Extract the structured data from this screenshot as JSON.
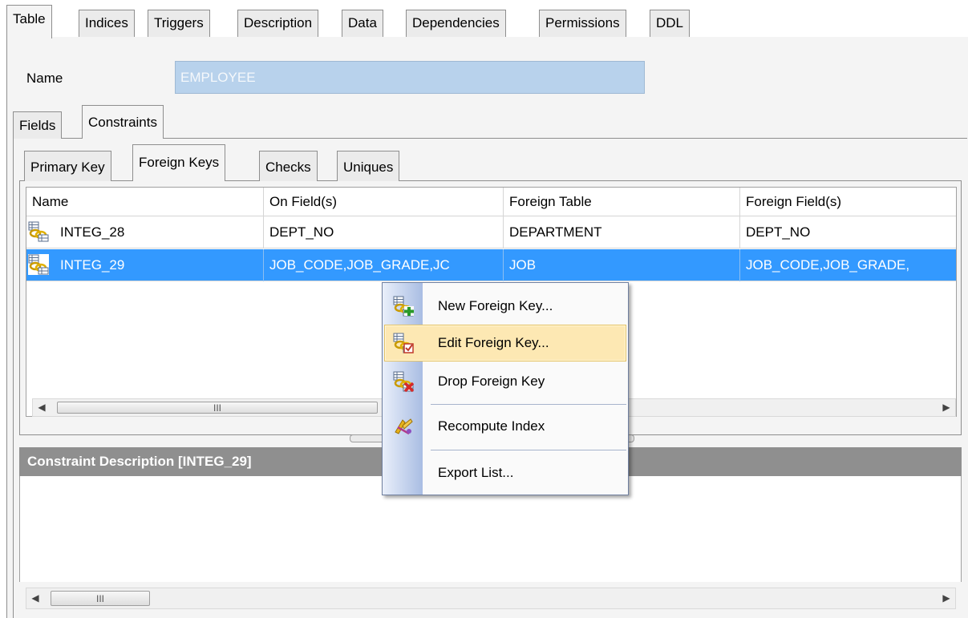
{
  "top_tabs": [
    {
      "label": "Table",
      "active": true
    },
    {
      "label": "Indices",
      "active": false
    },
    {
      "label": "Triggers",
      "active": false
    },
    {
      "label": "Description",
      "active": false
    },
    {
      "label": "Data",
      "active": false
    },
    {
      "label": "Dependencies",
      "active": false
    },
    {
      "label": "Permissions",
      "active": false
    },
    {
      "label": "DDL",
      "active": false
    }
  ],
  "name": {
    "label": "Name",
    "value": "EMPLOYEE"
  },
  "sub_tabs": [
    {
      "label": "Fields",
      "active": false
    },
    {
      "label": "Constraints",
      "active": true
    }
  ],
  "constraint_tabs": [
    {
      "label": "Primary Key",
      "active": false
    },
    {
      "label": "Foreign Keys",
      "active": true
    },
    {
      "label": "Checks",
      "active": false
    },
    {
      "label": "Uniques",
      "active": false
    }
  ],
  "grid": {
    "columns": [
      "Name",
      "On Field(s)",
      "Foreign Table",
      "Foreign Field(s)"
    ],
    "rows": [
      {
        "name": "INTEG_28",
        "on_fields": "DEPT_NO",
        "foreign_table": "DEPARTMENT",
        "foreign_fields": "DEPT_NO",
        "selected": false
      },
      {
        "name": "INTEG_29",
        "on_fields": "JOB_CODE,JOB_GRADE,JC",
        "foreign_table": "JOB",
        "foreign_fields": "JOB_CODE,JOB_GRADE,",
        "selected": true
      }
    ],
    "scroll_thumb_glyph": "III"
  },
  "description": {
    "header": "Constraint Description [INTEG_29]"
  },
  "context_menu": {
    "items": [
      {
        "label": "New Foreign Key...",
        "icon": "new-key-icon",
        "highlighted": false
      },
      {
        "label": "Edit Foreign Key...",
        "icon": "edit-key-icon",
        "highlighted": true
      },
      {
        "label": "Drop Foreign Key",
        "icon": "drop-key-icon",
        "highlighted": false
      },
      {
        "label": "Recompute Index",
        "icon": "recompute-icon",
        "highlighted": false
      },
      {
        "label": "Export List...",
        "icon": "",
        "highlighted": false
      }
    ]
  },
  "colors": {
    "selection": "#3399ff",
    "menu_highlight": "#fde8b3",
    "name_field_bg": "#b8d2ec",
    "description_header_bg": "#8f8f8f"
  }
}
